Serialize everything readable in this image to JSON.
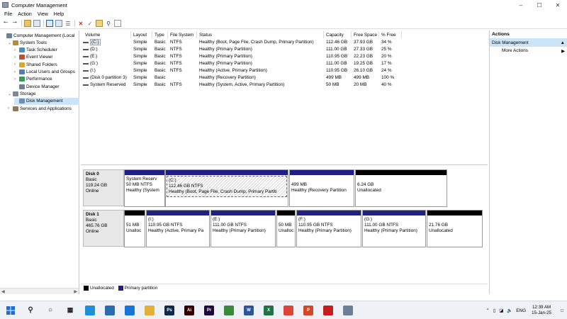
{
  "window": {
    "title": "Computer Management"
  },
  "menu": [
    "File",
    "Action",
    "View",
    "Help"
  ],
  "tree": [
    {
      "label": "Computer Management (Local",
      "indent": 0,
      "arrow": "",
      "color": "#6b7f99"
    },
    {
      "label": "System Tools",
      "indent": 1,
      "arrow": "v",
      "color": "#b58b3a"
    },
    {
      "label": "Task Scheduler",
      "indent": 2,
      "arrow": ">",
      "color": "#4c8cc9"
    },
    {
      "label": "Event Viewer",
      "indent": 2,
      "arrow": ">",
      "color": "#c14d3a"
    },
    {
      "label": "Shared Folders",
      "indent": 2,
      "arrow": ">",
      "color": "#d9a83a"
    },
    {
      "label": "Local Users and Groups",
      "indent": 2,
      "arrow": ">",
      "color": "#5a7bb0"
    },
    {
      "label": "Performance",
      "indent": 2,
      "arrow": ">",
      "color": "#3a9a5a"
    },
    {
      "label": "Device Manager",
      "indent": 2,
      "arrow": "",
      "color": "#6b7f99"
    },
    {
      "label": "Storage",
      "indent": 1,
      "arrow": "v",
      "color": "#7a8a9a"
    },
    {
      "label": "Disk Management",
      "indent": 2,
      "arrow": "",
      "color": "#6b8fb5",
      "selected": true
    },
    {
      "label": "Services and Applications",
      "indent": 1,
      "arrow": ">",
      "color": "#8a7a5a"
    }
  ],
  "volumes": {
    "headers": [
      "Volume",
      "Layout",
      "Type",
      "File System",
      "Status",
      "Capacity",
      "Free Space",
      "% Free"
    ],
    "rows": [
      [
        "(C:)",
        "Simple",
        "Basic",
        "NTFS",
        "Healthy (Boot, Page File, Crash Dump, Primary Partition)",
        "112.46 GB",
        "37.93 GB",
        "34 %"
      ],
      [
        "(D:)",
        "Simple",
        "Basic",
        "NTFS",
        "Healthy (Primary Partition)",
        "111.00 GB",
        "27.33 GB",
        "25 %"
      ],
      [
        "(E:)",
        "Simple",
        "Basic",
        "NTFS",
        "Healthy (Primary Partition)",
        "110.95 GB",
        "22.23 GB",
        "20 %"
      ],
      [
        "(G:)",
        "Simple",
        "Basic",
        "NTFS",
        "Healthy (Primary Partition)",
        "111.00 GB",
        "19.25 GB",
        "17 %"
      ],
      [
        "(I:)",
        "Simple",
        "Basic",
        "NTFS",
        "Healthy (Active, Primary Partition)",
        "110.95 GB",
        "26.10 GB",
        "24 %"
      ],
      [
        "(Disk 0 partition 3)",
        "Simple",
        "Basic",
        "",
        "Healthy (Recovery Partition)",
        "499 MB",
        "499 MB",
        "100 %"
      ],
      [
        "System Reserved",
        "Simple",
        "Basic",
        "NTFS",
        "Healthy (System, Active, Primary Partition)",
        "50 MB",
        "20 MB",
        "40 %"
      ]
    ]
  },
  "disks": [
    {
      "name": "Disk 0",
      "type": "Basic",
      "size": "119.24 GB",
      "status": "Online",
      "partitions": [
        {
          "line1": "System Reserv",
          "line2": "50 MB NTFS",
          "line3": "Healthy (System",
          "kind": "primary"
        },
        {
          "line1": "(C:)",
          "line2": "112.46 GB NTFS",
          "line3": "Healthy (Boot, Page File, Crash Dump, Primary Partiti",
          "kind": "primary",
          "hatched": true
        },
        {
          "line1": "",
          "line2": "499 MB",
          "line3": "Healthy (Recovery Partition",
          "kind": "primary"
        },
        {
          "line1": "",
          "line2": "6.24 GB",
          "line3": "Unallocated",
          "kind": "unalloc"
        }
      ]
    },
    {
      "name": "Disk 1",
      "type": "Basic",
      "size": "465.76 GB",
      "status": "Online",
      "partitions": [
        {
          "line1": "",
          "line2": "51 MB",
          "line3": "Unalloc",
          "kind": "unalloc"
        },
        {
          "line1": "(I:)",
          "line2": "110.95 GB NTFS",
          "line3": "Healthy (Active, Primary Pa",
          "kind": "primary"
        },
        {
          "line1": "(E:)",
          "line2": "111.00 GB NTFS",
          "line3": "Healthy (Primary Partition)",
          "kind": "primary"
        },
        {
          "line1": "",
          "line2": "50 MB",
          "line3": "Unalloc",
          "kind": "unalloc"
        },
        {
          "line1": "(F:)",
          "line2": "110.95 GB NTFS",
          "line3": "Healthy (Primary Partition)",
          "kind": "primary"
        },
        {
          "line1": "(G:)",
          "line2": "111.00 GB NTFS",
          "line3": "Healthy (Primary Partition)",
          "kind": "primary"
        },
        {
          "line1": "",
          "line2": "21.76 GB",
          "line3": "Unallocated",
          "kind": "unalloc"
        }
      ]
    }
  ],
  "legend": {
    "unallocated": "Unallocated",
    "primary": "Primary partition"
  },
  "actions": {
    "header": "Actions",
    "section": "Disk Management",
    "more": "More Actions"
  },
  "taskbar": {
    "apps": [
      {
        "name": "edge-icon",
        "color": "#1f8fd6",
        "text": ""
      },
      {
        "name": "store-icon",
        "color": "#2b6cb0",
        "text": ""
      },
      {
        "name": "mail-icon",
        "color": "#1a73d6",
        "text": ""
      },
      {
        "name": "file-explorer-icon",
        "color": "#e3b13a",
        "text": ""
      },
      {
        "name": "photoshop-icon",
        "color": "#0c2a4a",
        "text": "Ps"
      },
      {
        "name": "illustrator-icon",
        "color": "#330000",
        "text": "Ai"
      },
      {
        "name": "premiere-icon",
        "color": "#1d0a3a",
        "text": "Pr"
      },
      {
        "name": "coreldraw-icon",
        "color": "#3a8a3a",
        "text": ""
      },
      {
        "name": "word-icon",
        "color": "#2b579a",
        "text": "W"
      },
      {
        "name": "excel-icon",
        "color": "#217346",
        "text": "X"
      },
      {
        "name": "chrome-icon",
        "color": "#db4437",
        "text": ""
      },
      {
        "name": "powerpoint-icon",
        "color": "#d24726",
        "text": "P"
      },
      {
        "name": "acrobat-icon",
        "color": "#c41e1e",
        "text": ""
      },
      {
        "name": "computer-management-icon",
        "color": "#6b7f99",
        "text": ""
      }
    ],
    "lang": "ENG",
    "time": "12:39 AM",
    "date": "15-Jan-25"
  }
}
